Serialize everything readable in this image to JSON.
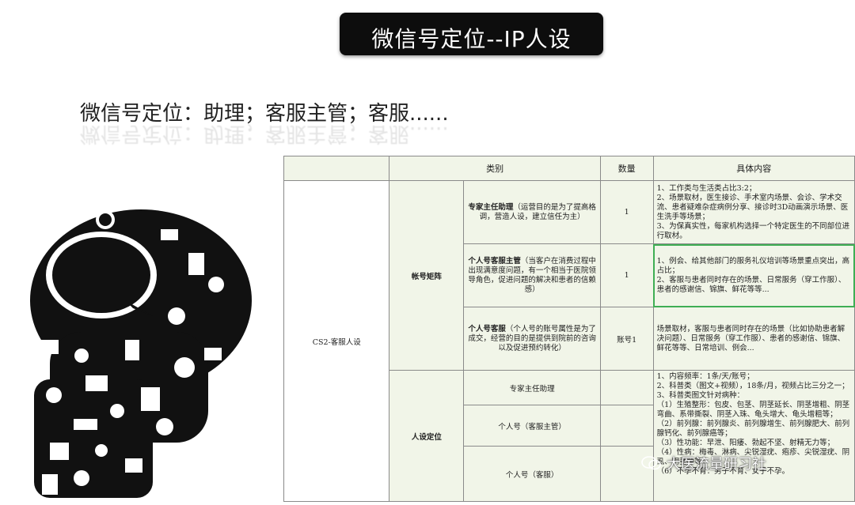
{
  "title": "微信号定位--IP人设",
  "subtitle": "微信号定位：助理；客服主管；客服......",
  "table": {
    "headers": [
      "类别",
      "数量",
      "具体内容"
    ],
    "section1": {
      "main": "CS2-客服人设",
      "group1": "帐号矩阵",
      "group2": "人设定位",
      "rows": [
        {
          "title": "专家主任助理",
          "desc": "（运营目的是为了提高格调，营造人设，建立信任为主）",
          "count": "1",
          "content": "1、工作类与生活类占比3:2；\n2、场景取材，医生接诊、手术室内场景、会诊、学术交流、患者疑难杂症病例分享、接诊时3D动画演示场景、医生洗手等场景；\n3、为保真实性，每家机构选择一个特定医生的不同部位进行取材。"
        },
        {
          "title": "个人号客服主管",
          "desc": "（当客户在消费过程中出现满意度问题，有一个相当于医院领导角色，促进问题的解决和患者的信赖感）",
          "count": "1",
          "content": "1、例会、给其他部门的服务礼仪培训等场景重点突出，高占比；\n2、客服与患者同时存在的场景、日常服务（穿工作服）、患者的感谢信、锦旗、鲜花等等..."
        },
        {
          "title": "个人号客服",
          "desc": "（个人号的账号属性是为了成交，经营的目的是提供到院前的咨询以及促进预约转化）",
          "count": "账号1",
          "content": "场景取材，客服与患者同时存在的场景（比如协助患者解决问题）、日常服务（穿工作服）、患者的感谢信、锦旗、鲜花等等、日常培训、例会..."
        }
      ],
      "rows2": [
        "专家主任助理",
        "个人号（客服主管）",
        "个人号（客服）"
      ],
      "content2": "1、内容频率：1条/天/账号；\n2、科普类（图文+视频），18条/月，视频占比三分之一；\n3、科普类图文针对病种：\n（1）生殖整形：包皮、包茎、阴茎延长、阴茎增粗、阴茎弯曲、系带撕裂、阴茎入珠、龟头增大、龟头增粗等；\n（2）前列腺：前列腺炎、前列腺增生、前列腺肥大、前列腺钙化、前列腺癌等；\n（3）性功能：早泄、阳痿、勃起不坚、射精无力等；\n（4）性病：梅毒、淋病、尖锐湿疣、疱疹、尖锐湿疣、阴虱、阴茎肿等；\n（6）不孕不育：男子不育、女子不孕。"
    }
  },
  "watermark": "大医流量研习社",
  "colors": {
    "accent": "#3fae54",
    "header_bg": "#f1f5e8",
    "title_bg": "#0d0d0d"
  }
}
